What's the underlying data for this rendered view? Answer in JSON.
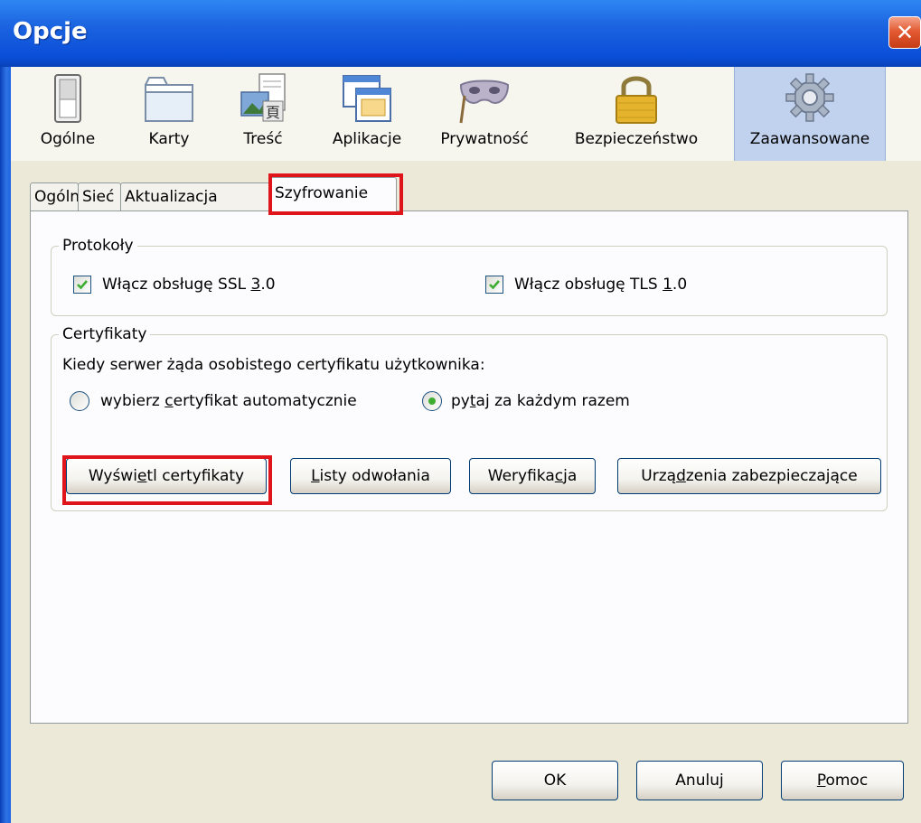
{
  "window": {
    "title": "Opcje",
    "close_glyph": "✕"
  },
  "toolbar": {
    "items": [
      {
        "label": "Ogólne",
        "icon": "switch-icon"
      },
      {
        "label": "Karty",
        "icon": "tabs-icon"
      },
      {
        "label": "Treść",
        "icon": "content-icon"
      },
      {
        "label": "Aplikacje",
        "icon": "applications-icon"
      },
      {
        "label": "Prywatność",
        "icon": "mask-icon"
      },
      {
        "label": "Bezpieczeństwo",
        "icon": "padlock-icon"
      },
      {
        "label": "Zaawansowane",
        "icon": "gear-icon"
      }
    ],
    "selected": "Zaawansowane"
  },
  "tabs": {
    "items": [
      "Ogólne",
      "Sieć",
      "Aktualizacja",
      "Szyfrowanie"
    ],
    "selected": "Szyfrowanie"
  },
  "protocols": {
    "legend": "Protokoły",
    "ssl": {
      "label_pre": "Włącz obsługę SSL ",
      "label_key": "3",
      "label_post": ".0",
      "checked": true
    },
    "tls": {
      "label_pre": "Włącz obsługę TLS ",
      "label_key": "1",
      "label_post": ".0",
      "checked": true
    }
  },
  "certificates": {
    "legend": "Certyfikaty",
    "prompt": "Kiedy serwer żąda osobistego certyfikatu użytkownika:",
    "radio_auto": {
      "pre": "wybierz ",
      "key": "c",
      "post": "ertyfikat automatycznie",
      "selected": false
    },
    "radio_ask": {
      "pre": "py",
      "key": "t",
      "post": "aj za każdym razem",
      "selected": true
    },
    "buttons": {
      "view": {
        "pre": "Wyświ",
        "key": "e",
        "post": "tl certyfikaty"
      },
      "revocation": {
        "pre": "",
        "key": "L",
        "post": "isty odwołania"
      },
      "verification": {
        "pre": "Weryfika",
        "key": "c",
        "post": "ja"
      },
      "devices": {
        "pre": "Urzą",
        "key": "d",
        "post": "zenia zabezpieczające"
      }
    }
  },
  "dialog_buttons": {
    "ok": "OK",
    "cancel": "Anuluj",
    "help": {
      "key": "P",
      "post": "omoc"
    }
  },
  "colors": {
    "highlight": "#e0141b",
    "titlebar": "#0a4ed8",
    "selected_toolbar": "#c1d2ee",
    "check_mark": "#3fad32"
  }
}
